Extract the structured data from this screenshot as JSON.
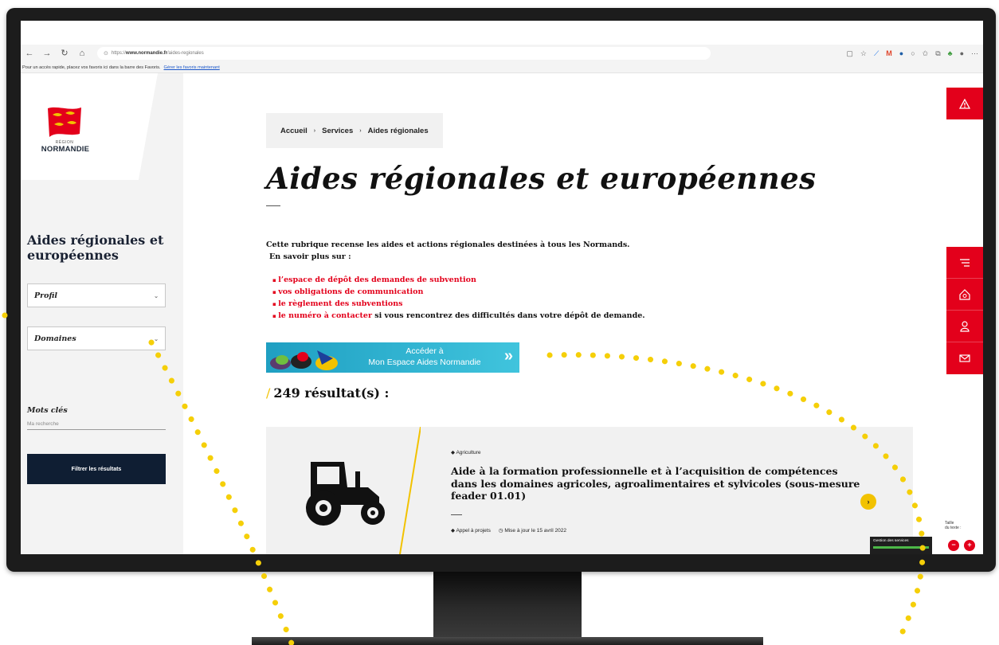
{
  "browser": {
    "url_prefix": "https://",
    "url_host": "www.normandie.fr",
    "url_path": "/aides-regionales",
    "favorites_bar_text": "Pour un accès rapide, placez vos favoris ici dans la barre des Favoris.",
    "favorites_link": "Gérer les favoris maintenant"
  },
  "logo": {
    "small": "RÉGION",
    "name": "NORMANDIE"
  },
  "sidebar": {
    "title": "Aides régionales et européennes",
    "profile_select": "Profil",
    "domains_select": "Domaines",
    "keywords_label": "Mots clés",
    "keywords_placeholder": "Ma recherche",
    "filter_button": "Filtrer les résultats"
  },
  "breadcrumb": {
    "home": "Accueil",
    "services": "Services",
    "current": "Aides régionales"
  },
  "page": {
    "title": "Aides régionales et européennes",
    "intro": "Cette rubrique recense les aides et actions régionales destinées à tous les Normands.",
    "learn_more": "En savoir plus sur :",
    "links": [
      {
        "link": "l’espace de dépôt des demandes de subvention",
        "rest": ""
      },
      {
        "link": "vos obligations de communication",
        "rest": ""
      },
      {
        "link": "le règlement des subventions",
        "rest": ""
      },
      {
        "link": "le numéro à contacter",
        "rest": " si vous rencontrez des difficultés dans votre dépôt de demande."
      }
    ],
    "banner_line1": "Accéder à",
    "banner_line2": "Mon Espace Aides Normandie",
    "results": "249 résultat(s) :"
  },
  "card": {
    "tag": "Agriculture",
    "title": "Aide à la formation professionnelle et à l’acquisition de compétences dans les domaines agricoles, agroalimentaires et sylvicoles (sous-mesure feader 01.01)",
    "type": "Appel à projets",
    "updated": "Mise à jour le 15 avril 2022"
  },
  "text_size": {
    "label_line1": "Taille",
    "label_line2": "du texte :",
    "minus": "−",
    "plus": "+"
  },
  "cookie_widget": "Gestion des services",
  "colors": {
    "brand_red": "#e3001b",
    "accent_yellow": "#f2c200",
    "navy": "#0f1e33",
    "banner_blue": "#1f9fc2"
  },
  "icons": [
    "back-icon",
    "forward-icon",
    "reload-icon",
    "home-icon",
    "alert-icon",
    "filter-icon",
    "house-search-icon",
    "user-icon",
    "mail-icon",
    "tractor-icon",
    "tag-icon",
    "clock-icon"
  ]
}
